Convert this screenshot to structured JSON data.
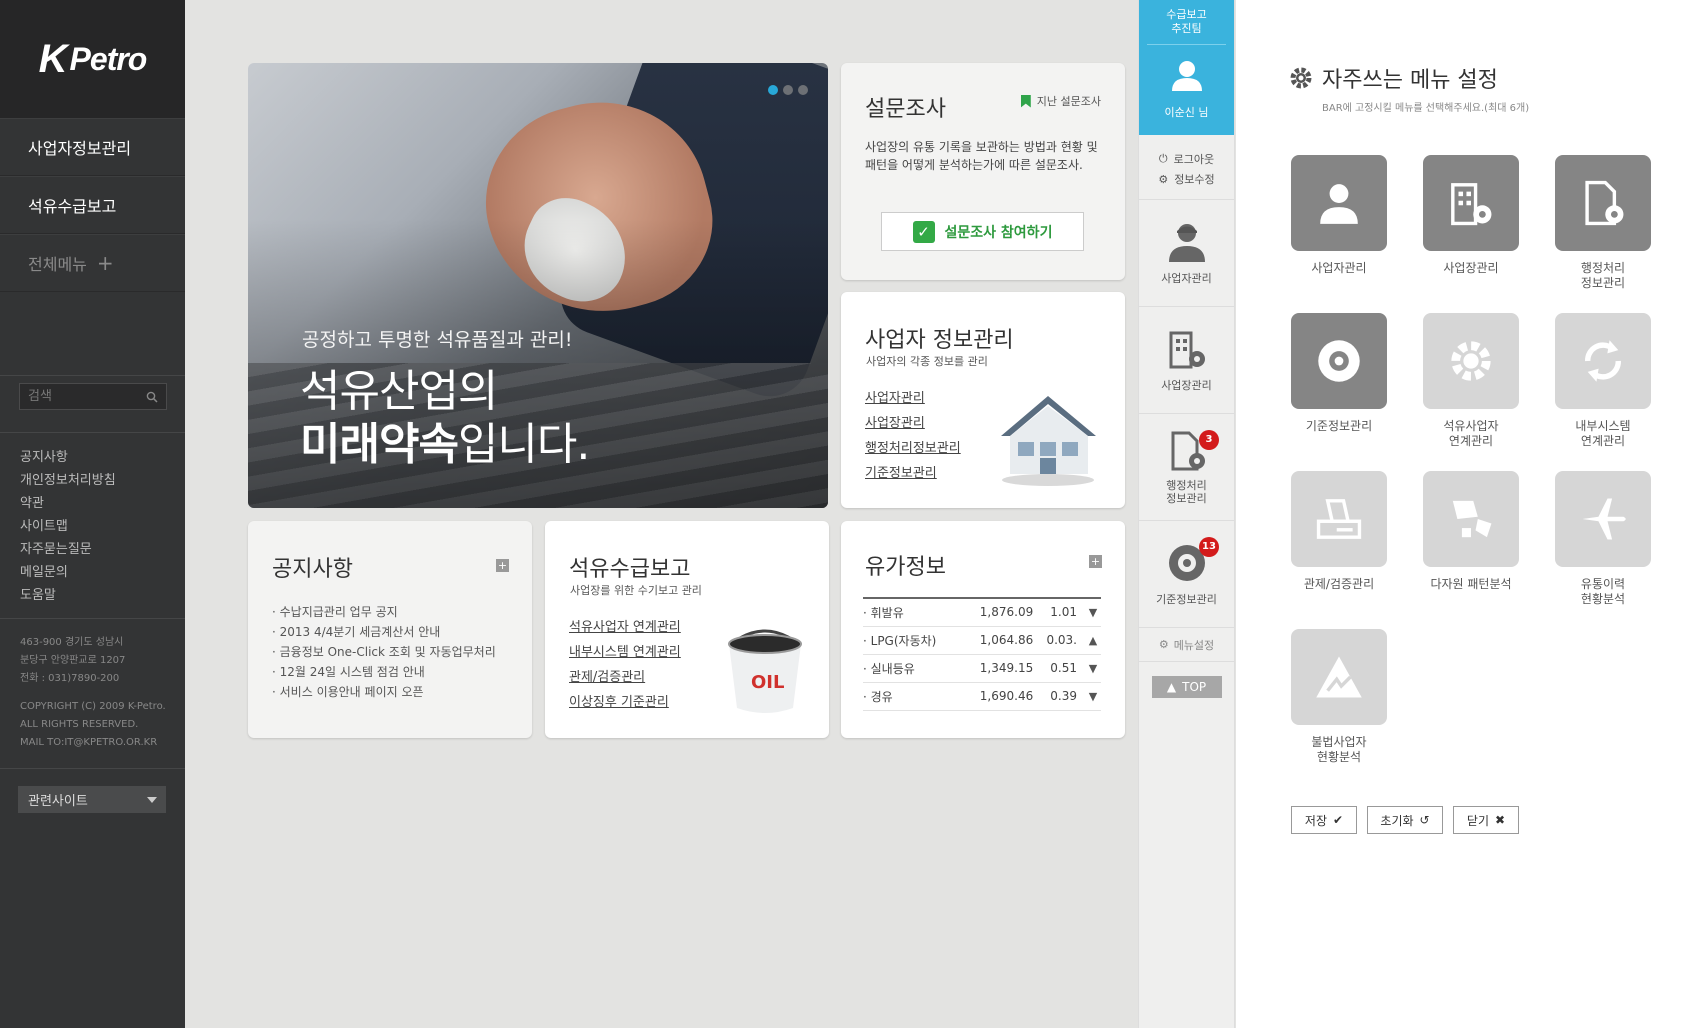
{
  "brand": {
    "logo_k": "K",
    "logo_rest": "Petro"
  },
  "sidebar": {
    "nav": [
      "사업자정보관리",
      "석유수급보고"
    ],
    "all_menu": "전체메뉴",
    "search_placeholder": "검색",
    "links": [
      "공지사항",
      "개인정보처리방침",
      "약관",
      "사이트맵",
      "자주묻는질문",
      "메일문의",
      "도움말"
    ],
    "address": [
      "463-900 경기도 성남시",
      "분당구 안양판교로 1207",
      "전화 : 031)7890-200"
    ],
    "copyright": [
      "COPYRIGHT (C) 2009 K-Petro.",
      "ALL RIGHTS RESERVED.",
      "MAIL TO:IT@KPETRO.OR.KR"
    ],
    "related": "관련사이트"
  },
  "hero": {
    "sub": "공정하고 투명한 석유품질과 관리!",
    "title1": "석유산업의",
    "title2_bold": "미래약속",
    "title2_rest": "입니다."
  },
  "survey": {
    "title": "설문조사",
    "past": "지난 설문조사",
    "desc": "사업장의 유통 기록을 보관하는 방법과 현황 및 패턴을 어떻게 분석하는가에 따른 설문조사.",
    "button": "설문조사 참여하기"
  },
  "bizinfo": {
    "title": "사업자 정보관리",
    "sub": "사업자의 각종 정보를 관리",
    "links": [
      "사업자관리",
      "사업장관리",
      "행정처리정보관리",
      "기준정보관리"
    ]
  },
  "notice": {
    "title": "공지사항",
    "items": [
      "· 수납지급관리 업무 공지",
      "· 2013 4/4분기 세금계산서 안내",
      "· 금융정보 One-Click 조회 및 자동업무처리",
      "· 12월 24일 시스템 점검 안내",
      "· 서비스 이용안내 페이지 오픈"
    ]
  },
  "supply": {
    "title": "석유수급보고",
    "sub": "사업장를 위한 수기보고 관리",
    "links": [
      "석유사업자 연계관리",
      "내부시스템 연계관리",
      "관제/검증관리",
      "이상징후 기준관리"
    ],
    "bucket_text": "OIL"
  },
  "price": {
    "title": "유가정보",
    "rows": [
      {
        "name": "· 휘발유",
        "price": "1,876.09",
        "change": "1.01",
        "dir": "▼"
      },
      {
        "name": "· LPG(자동차)",
        "price": "1,064.86",
        "change": "0.03.",
        "dir": "▲"
      },
      {
        "name": "· 실내등유",
        "price": "1,349.15",
        "change": "0.51",
        "dir": "▼"
      },
      {
        "name": "· 경유",
        "price": "1,690.46",
        "change": "0.39",
        "dir": "▼"
      }
    ]
  },
  "strip": {
    "team": "수급보고\n추진팀",
    "user": "이순신 님",
    "logout": "로그아웃",
    "edit": "정보수정",
    "items": [
      {
        "label": "사업자관리",
        "icon": "person-icon"
      },
      {
        "label": "사업장관리",
        "icon": "building-gear-icon"
      },
      {
        "label": "행정처리\n정보관리",
        "icon": "document-gear-icon",
        "badge": "3"
      },
      {
        "label": "기준정보관리",
        "icon": "disc-icon",
        "badge": "13"
      }
    ],
    "menu_setting": "메뉴설정",
    "top": "TOP"
  },
  "panel": {
    "title": "자주쓰는 메뉴 설정",
    "desc": "BAR에 고정시킬 메뉴를 선택해주세요.(최대 6개)",
    "tiles": [
      {
        "label": "사업자관리",
        "icon": "person-icon",
        "selected": true
      },
      {
        "label": "사업장관리",
        "icon": "building-gear-icon",
        "selected": true
      },
      {
        "label": "행정처리\n정보관리",
        "icon": "document-gear-icon",
        "selected": true
      },
      {
        "label": "기준정보관리",
        "icon": "disc-icon",
        "selected": true
      },
      {
        "label": "석유사업자\n연계관리",
        "icon": "link-gear-icon",
        "selected": false
      },
      {
        "label": "내부시스템\n연계관리",
        "icon": "recycle-arrows-icon",
        "selected": false
      },
      {
        "label": "관제/검증관리",
        "icon": "printer-icon",
        "selected": false
      },
      {
        "label": "다자원 패턴분석",
        "icon": "pattern-icon",
        "selected": false
      },
      {
        "label": "유통이력\n현황분석",
        "icon": "airplane-icon",
        "selected": false
      },
      {
        "label": "불법사업자\n현황분석",
        "icon": "warning-triangle-icon",
        "selected": false
      }
    ],
    "save": "저장",
    "reset": "초기화",
    "close": "닫기"
  },
  "colors": {
    "accent": "#3ab3dd",
    "sidebar": "#333435",
    "tile_on": "#858585",
    "tile_off": "#d6d6d6",
    "badge": "#d31b1b",
    "survey_green": "#33a946"
  }
}
